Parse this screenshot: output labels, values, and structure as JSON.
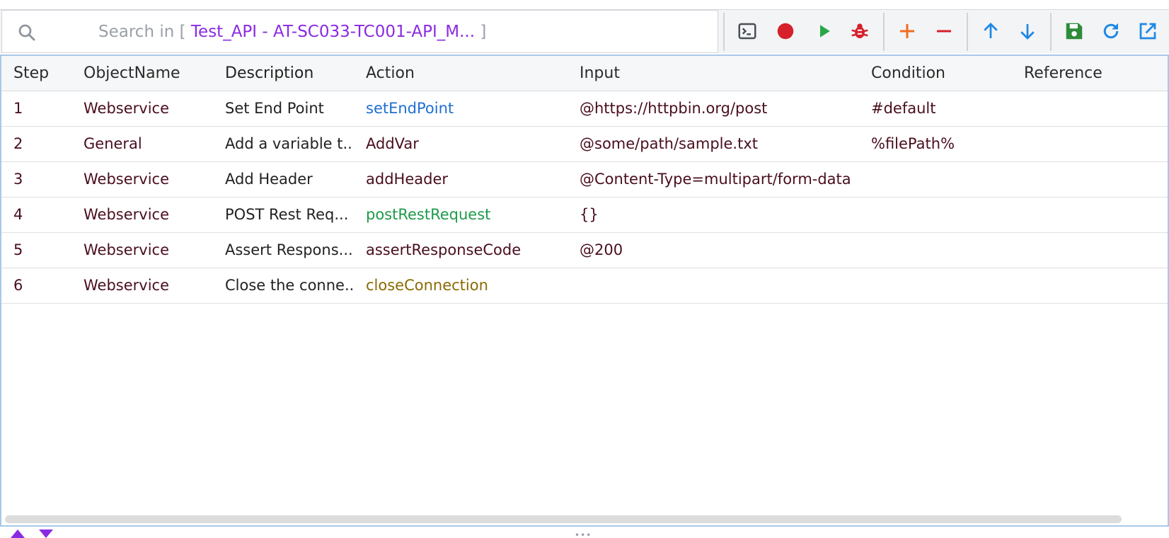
{
  "search": {
    "prefix": "Search in",
    "open_bracket": "[",
    "target": "Test_API - AT-SC033-TC001-API_M...",
    "close_bracket": "]"
  },
  "toolbar": {
    "buttons": [
      {
        "name": "console-icon",
        "color": "#4a4f57"
      },
      {
        "name": "record-icon",
        "color": "#d6202b"
      },
      {
        "name": "play-icon",
        "color": "#28a745"
      },
      {
        "name": "debug-icon",
        "color": "#d6202b"
      },
      {
        "name": "add-icon",
        "color": "#f26b1d"
      },
      {
        "name": "remove-icon",
        "color": "#d6202b"
      },
      {
        "name": "arrow-up-icon",
        "color": "#1e88e5"
      },
      {
        "name": "arrow-down-icon",
        "color": "#1e88e5"
      },
      {
        "name": "save-icon",
        "color": "#2e8b3a"
      },
      {
        "name": "refresh-icon",
        "color": "#1e88e5"
      },
      {
        "name": "open-external-icon",
        "color": "#1e88e5"
      }
    ]
  },
  "table": {
    "headers": {
      "step": "Step",
      "object": "ObjectName",
      "description": "Description",
      "action": "Action",
      "input": "Input",
      "condition": "Condition",
      "reference": "Reference"
    },
    "rows": [
      {
        "step": "1",
        "object": "Webservice",
        "description": "Set End Point",
        "action": "setEndPoint",
        "action_color": "#1f6fd1",
        "input": "@https://httpbin.org/post",
        "condition": "#default",
        "reference": ""
      },
      {
        "step": "2",
        "object": "General",
        "description": "Add a variable t...",
        "action": "AddVar",
        "action_color": "#4a0e1e",
        "input": "@some/path/sample.txt",
        "condition": "%filePath%",
        "reference": ""
      },
      {
        "step": "3",
        "object": "Webservice",
        "description": "Add Header",
        "action": "addHeader",
        "action_color": "#4a0e1e",
        "input": "@Content-Type=multipart/form-data",
        "condition": "",
        "reference": ""
      },
      {
        "step": "4",
        "object": "Webservice",
        "description": "POST Rest Req...",
        "action": "postRestRequest",
        "action_color": "#1e9a4a",
        "input": "{}",
        "condition": "",
        "reference": ""
      },
      {
        "step": "5",
        "object": "Webservice",
        "description": "Assert Respons...",
        "action": "assertResponseCode",
        "action_color": "#4a0e1e",
        "input": "@200",
        "condition": "",
        "reference": ""
      },
      {
        "step": "6",
        "object": "Webservice",
        "description": "Close the conne...",
        "action": "closeConnection",
        "action_color": "#8a6a00",
        "input": "",
        "condition": "",
        "reference": ""
      }
    ]
  },
  "colors": {
    "accent": "#8a2be2",
    "row_text": "#4a0e1e",
    "grid_border": "#a8c8e8"
  }
}
